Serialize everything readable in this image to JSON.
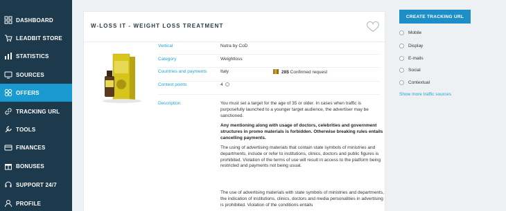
{
  "sidebar": {
    "items": [
      {
        "label": "Dashboard",
        "icon": "dashboard-icon"
      },
      {
        "label": "Leadbit Store",
        "icon": "store-icon"
      },
      {
        "label": "Statistics",
        "icon": "statistics-icon"
      },
      {
        "label": "Sources",
        "icon": "sources-icon"
      },
      {
        "label": "Offers",
        "icon": "offers-icon",
        "active": true
      },
      {
        "label": "Tracking URL",
        "icon": "link-icon"
      },
      {
        "label": "Tools",
        "icon": "tools-icon"
      },
      {
        "label": "Finances",
        "icon": "finances-icon"
      },
      {
        "label": "Bonuses",
        "icon": "bonuses-icon"
      },
      {
        "label": "Support 24/7",
        "icon": "support-icon"
      },
      {
        "label": "Profile",
        "icon": "profile-icon"
      }
    ]
  },
  "offer": {
    "title": "W-LOSS IT - WEIGHT LOSS TREATMENT",
    "vertical_label": "Vertical",
    "vertical_value": "Nutra by CoD",
    "category_label": "Category",
    "category_value": "Weightloss",
    "countries_label": "Countries and payments",
    "country": "Italy",
    "payout": "28$",
    "payout_note": "Confirmed request",
    "contest_label": "Contest points",
    "contest_value": "4",
    "description_label": "Description",
    "description": [
      "You must set a target for the age of 35 or older. In cases when traffic is purposefully launched to a younger target audience, the advertiser may be sanctioned.",
      "Any mentioning along with usage of doctors, celebrities and government structures in promo materials is forbidden. Otherwise breaking rules entails cancelling payments.",
      "The using of advertising materials that contain state symbols of ministries and departments, include or refer to institutions, clinics, doctors and public figures is prohibited. Violation of the terms of use will result in access to the platform being restricted and payments not being usual.",
      "The use of advertising materials with state symbols of ministries and departments, the indication of institutions, clinics, doctors and media personalities in advertising is prohibited. Violation of the conditions entails"
    ]
  },
  "right_panel": {
    "cta_label": "Create tracking URL",
    "traffic_sources": [
      "Mobile",
      "Display",
      "E-mails",
      "Social",
      "Contextual"
    ],
    "show_more": "Show more traffic sources"
  },
  "colors": {
    "sidebar_bg": "#1d3a4d",
    "active": "#199bd2",
    "accent": "#21a3d6",
    "cta": "#1e8fc6"
  }
}
